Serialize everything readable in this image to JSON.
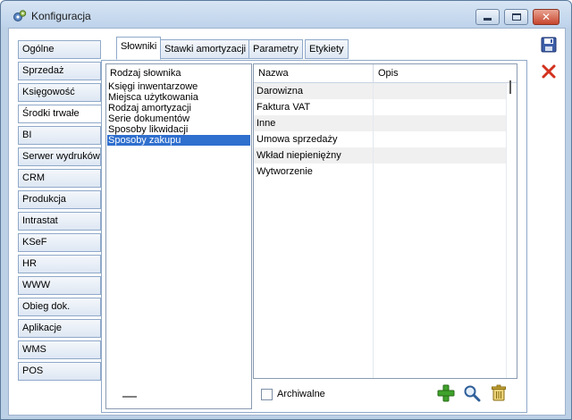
{
  "window": {
    "title": "Konfiguracja",
    "app_icon": "gears-icon"
  },
  "nav": {
    "items": [
      {
        "label": "Ogólne",
        "active": false
      },
      {
        "label": "Sprzedaż",
        "active": false
      },
      {
        "label": "Księgowość",
        "active": false
      },
      {
        "label": "Środki trwałe",
        "active": true
      },
      {
        "label": "BI",
        "active": false
      },
      {
        "label": "Serwer wydruków",
        "active": false
      },
      {
        "label": "CRM",
        "active": false
      },
      {
        "label": "Produkcja",
        "active": false
      },
      {
        "label": "Intrastat",
        "active": false
      },
      {
        "label": "KSeF",
        "active": false
      },
      {
        "label": "HR",
        "active": false
      },
      {
        "label": "WWW",
        "active": false
      },
      {
        "label": "Obieg dok.",
        "active": false
      },
      {
        "label": "Aplikacje",
        "active": false
      },
      {
        "label": "WMS",
        "active": false
      },
      {
        "label": "POS",
        "active": false
      }
    ]
  },
  "tabs": [
    {
      "label": "Słowniki",
      "active": true
    },
    {
      "label": "Stawki amortyzacji",
      "active": false
    },
    {
      "label": "Parametry",
      "active": false
    },
    {
      "label": "Etykiety",
      "active": false
    }
  ],
  "dictionary": {
    "header": "Rodzaj słownika",
    "items": [
      {
        "label": "Księgi inwentarzowe",
        "selected": false
      },
      {
        "label": "Miejsca użytkowania",
        "selected": false
      },
      {
        "label": "Rodzaj amortyzacji",
        "selected": false
      },
      {
        "label": "Serie dokumentów",
        "selected": false
      },
      {
        "label": "Sposoby likwidacji",
        "selected": false
      },
      {
        "label": "Sposoby zakupu",
        "selected": true
      }
    ]
  },
  "grid": {
    "columns": [
      "Nazwa",
      "Opis"
    ],
    "rows": [
      {
        "nazwa": "Darowizna",
        "opis": ""
      },
      {
        "nazwa": "Faktura VAT",
        "opis": ""
      },
      {
        "nazwa": "Inne",
        "opis": ""
      },
      {
        "nazwa": "Umowa sprzedaży",
        "opis": ""
      },
      {
        "nazwa": "Wkład niepieniężny",
        "opis": ""
      },
      {
        "nazwa": "Wytworzenie",
        "opis": ""
      }
    ]
  },
  "footer": {
    "archival_label": "Archiwalne",
    "archival_checked": false,
    "buttons": [
      "add-icon",
      "search-icon",
      "delete-icon"
    ]
  },
  "side_buttons": [
    "save-icon",
    "cancel-icon"
  ],
  "colors": {
    "selection": "#2f6fce",
    "add_green": "#3fa22b",
    "cancel_red": "#d3321f"
  }
}
